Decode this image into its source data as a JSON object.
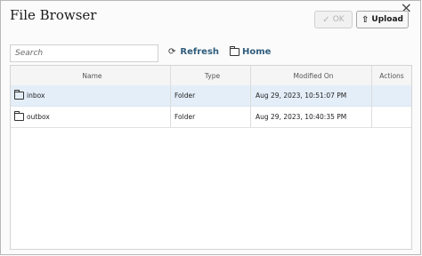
{
  "dialog": {
    "title": "File Browser",
    "close": "×"
  },
  "toolbar": {
    "ok_label": "OK",
    "upload_label": "Upload",
    "refresh_label": "Refresh",
    "home_label": "Home"
  },
  "search": {
    "placeholder": "Search",
    "value": ""
  },
  "table": {
    "columns": [
      "Name",
      "Type",
      "Modified On",
      "Actions"
    ],
    "rows": [
      {
        "name": "inbox",
        "type": "Folder",
        "modified": "Aug 29, 2023, 10:51:07 PM",
        "actions": ""
      },
      {
        "name": "outbox",
        "type": "Folder",
        "modified": "Aug 29, 2023, 10:40:35 PM",
        "actions": ""
      }
    ]
  },
  "colors": {
    "selected_row": "#e4eef8",
    "link": "#2f5d7c"
  }
}
